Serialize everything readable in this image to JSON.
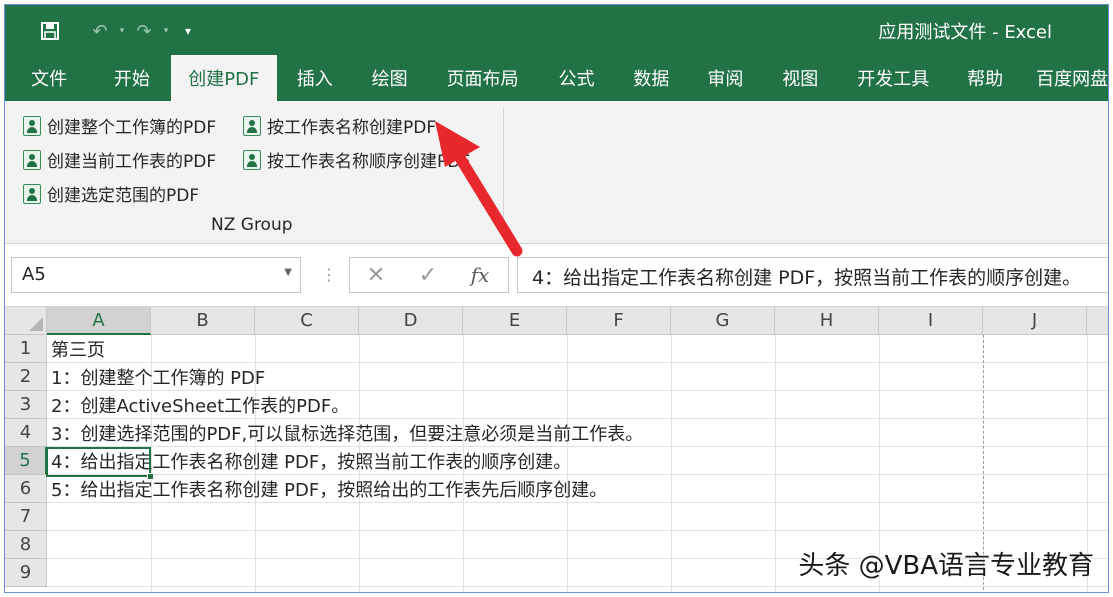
{
  "window": {
    "title": "应用测试文件 - Excel",
    "qat": [
      {
        "icon": "save-icon",
        "glyph": "🖫"
      },
      {
        "icon": "undo-icon",
        "glyph": "↶"
      },
      {
        "icon": "redo-icon",
        "glyph": "↷"
      },
      {
        "icon": "customize-qat-icon",
        "glyph": "▾"
      }
    ]
  },
  "ribbon_tabs": [
    "文件",
    "开始",
    "创建PDF",
    "插入",
    "绘图",
    "页面布局",
    "公式",
    "数据",
    "审阅",
    "视图",
    "开发工具",
    "帮助",
    "百度网盘"
  ],
  "active_tab": "创建PDF",
  "ribbon": {
    "buttons": [
      "创建整个工作簿的PDF",
      "按工作表名称创建PDF",
      "创建当前工作表的PDF",
      "按工作表名称顺序创建PDF",
      "创建选定范围的PDF"
    ],
    "group_label": "NZ Group"
  },
  "formula_bar": {
    "name_box": "A5",
    "cancel_glyph": "✕",
    "enter_glyph": "✓",
    "fx_label": "fx",
    "formula": "4：给出指定工作表名称创建 PDF，按照当前工作表的顺序创建。"
  },
  "sheet": {
    "columns": [
      "A",
      "B",
      "C",
      "D",
      "E",
      "F",
      "G",
      "H",
      "I",
      "J"
    ],
    "selected_column": "A",
    "rows": [
      "1",
      "2",
      "3",
      "4",
      "5",
      "6",
      "7",
      "8",
      "9"
    ],
    "selected_row": "5",
    "cells": [
      "第三页",
      "1：创建整个工作簿的 PDF",
      "2：创建ActiveSheet工作表的PDF。",
      "3：创建选择范围的PDF,可以鼠标选择范围，但要注意必须是当前工作表。",
      "4：给出指定工作表名称创建 PDF，按照当前工作表的顺序创建。",
      "5：给出指定工作表名称创建 PDF，按照给出的工作表先后顺序创建。"
    ],
    "active_cell": "A5"
  },
  "colors": {
    "excel_green": "#217346",
    "arrow_red": "#e8282c"
  },
  "watermark": "头条 @VBA语言专业教育"
}
